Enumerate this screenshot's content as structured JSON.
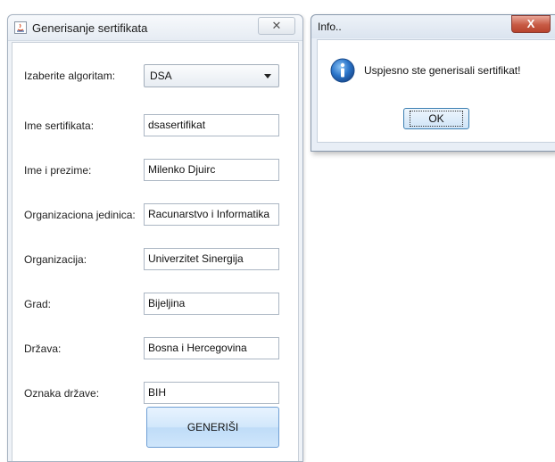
{
  "main_window": {
    "title": "Generisanje sertifikata",
    "close_glyph": "✕",
    "app_icon": "java-app-icon",
    "form": {
      "algorithm": {
        "label": "Izaberite algoritam:",
        "value": "DSA"
      },
      "fields": [
        {
          "key": "cert_name",
          "label": "Ime sertifikata:",
          "value": "dsasertifikat"
        },
        {
          "key": "full_name",
          "label": "Ime i prezime:",
          "value": "Milenko Djuirc"
        },
        {
          "key": "org_unit",
          "label": "Organizaciona jedinica:",
          "value": "Racunarstvo i Informatika"
        },
        {
          "key": "organization",
          "label": "Organizacija:",
          "value": "Univerzitet Sinergija"
        },
        {
          "key": "city",
          "label": "Grad:",
          "value": "Bijeljina"
        },
        {
          "key": "country",
          "label": "Država:",
          "value": "Bosna i Hercegovina"
        },
        {
          "key": "country_code",
          "label": "Oznaka države:",
          "value": "BIH"
        }
      ],
      "generate_label": "GENERIŠI"
    }
  },
  "info_dialog": {
    "title": "Info..",
    "close_glyph": "X",
    "icon": "info-icon",
    "message": "Uspjesno ste generisali sertifikat!",
    "ok_label": "OK"
  },
  "colors": {
    "close_button_red": "#c75a44",
    "button_blue": "#bfdcf8",
    "info_icon_blue": "#1f63b8"
  }
}
